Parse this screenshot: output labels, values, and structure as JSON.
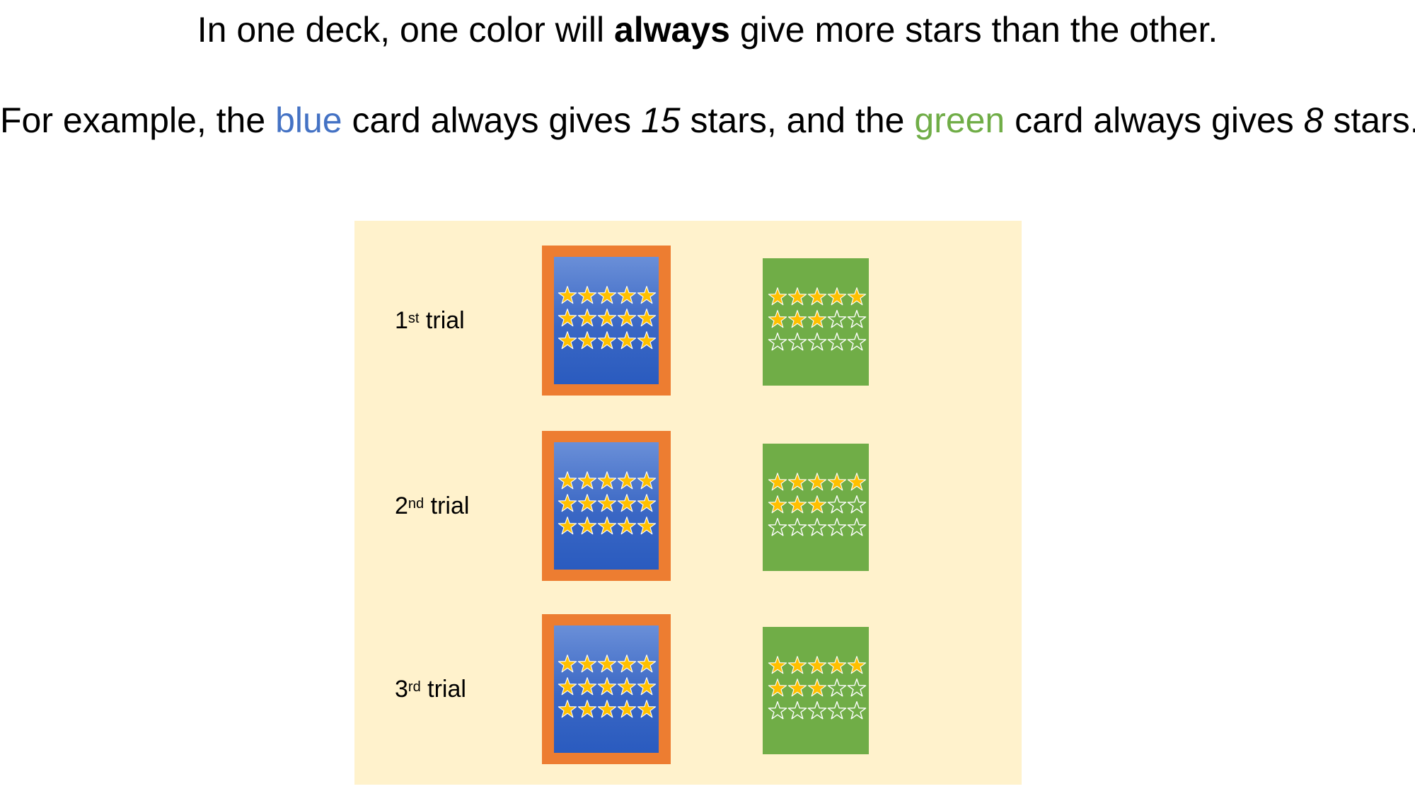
{
  "headline": {
    "before": "In one deck, one color will ",
    "emphasis": "always",
    "after": " give more stars than the other."
  },
  "example": {
    "part1": "For example, the ",
    "blue_word": "blue",
    "part2": " card always gives ",
    "blue_count": "15",
    "part3": " stars, and the ",
    "green_word": "green",
    "part4": " card always gives ",
    "green_count": "8",
    "part5": " stars."
  },
  "trials": [
    {
      "number": "1",
      "suffix": "st",
      "label": " trial"
    },
    {
      "number": "2",
      "suffix": "nd",
      "label": " trial"
    },
    {
      "number": "3",
      "suffix": "rd",
      "label": " trial"
    }
  ],
  "cards": {
    "stars_total": 15,
    "blue_filled": 15,
    "green_filled": 8,
    "selected": "blue"
  },
  "colors": {
    "blue_text": "#4472c4",
    "green_text": "#70ad47",
    "panel_bg": "#fff2cc",
    "selected_frame": "#ed7d31",
    "star_fill": "#ffc000",
    "star_outline": "#ffffff"
  },
  "icons": {
    "filled_star": "filled-star-icon",
    "empty_star": "empty-star-icon"
  }
}
